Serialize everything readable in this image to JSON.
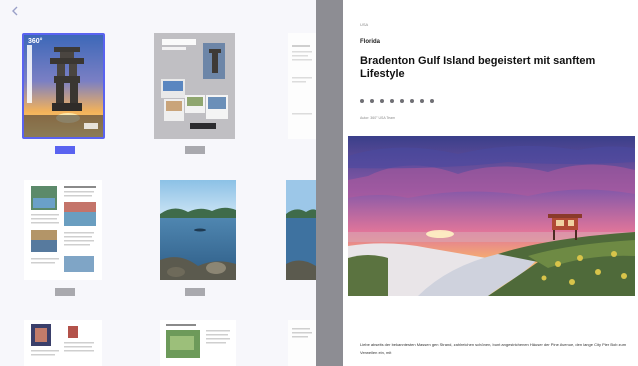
{
  "icons": {
    "back": "chevron-left-icon",
    "share": [
      "facebook-icon",
      "twitter-icon",
      "pinterest-icon",
      "whatsapp-icon",
      "email-icon",
      "print-icon",
      "flipboard-icon",
      "more-icon"
    ]
  },
  "colors": {
    "active_marker": "#5a63f0",
    "inactive_marker": "#a9a9ae",
    "panel_bg": "#f7f7fb"
  },
  "thumbnails": {
    "cover_masthead": "360°",
    "active_page": 1
  },
  "article": {
    "breadcrumb": "USA",
    "category": "Florida",
    "headline": "Bradenton Gulf Island begeistert mit sanftem Lifestyle",
    "byline": "Autor: 360° USA Team",
    "body": "Liebe abseits der bekanntesten Massen gen Strand, zahlreichen schönen, bunt angestrichenen Häuser der Pine Avenue, den lange City Pier Bob zum Verweilen ein, mit"
  }
}
